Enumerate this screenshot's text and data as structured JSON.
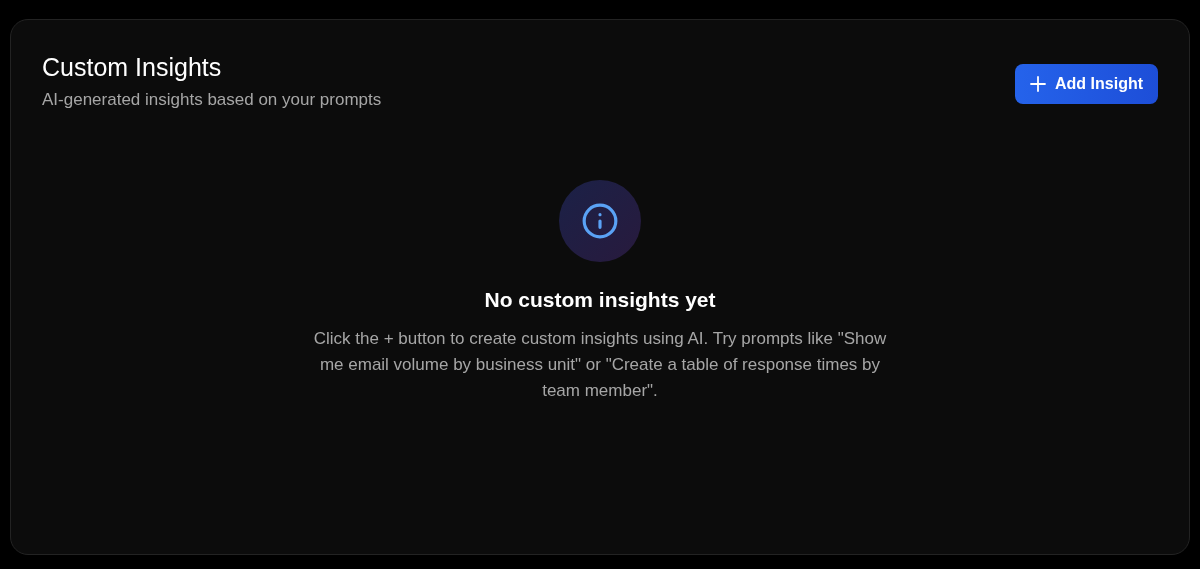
{
  "header": {
    "title": "Custom Insights",
    "subtitle": "AI-generated insights based on your prompts",
    "add_button": {
      "label": "Add Insight"
    }
  },
  "empty_state": {
    "title": "No custom insights yet",
    "message": "Click the + button to create custom insights using AI. Try prompts like \"Show me email volume by business unit\" or \"Create a table of response times by team member\"."
  }
}
